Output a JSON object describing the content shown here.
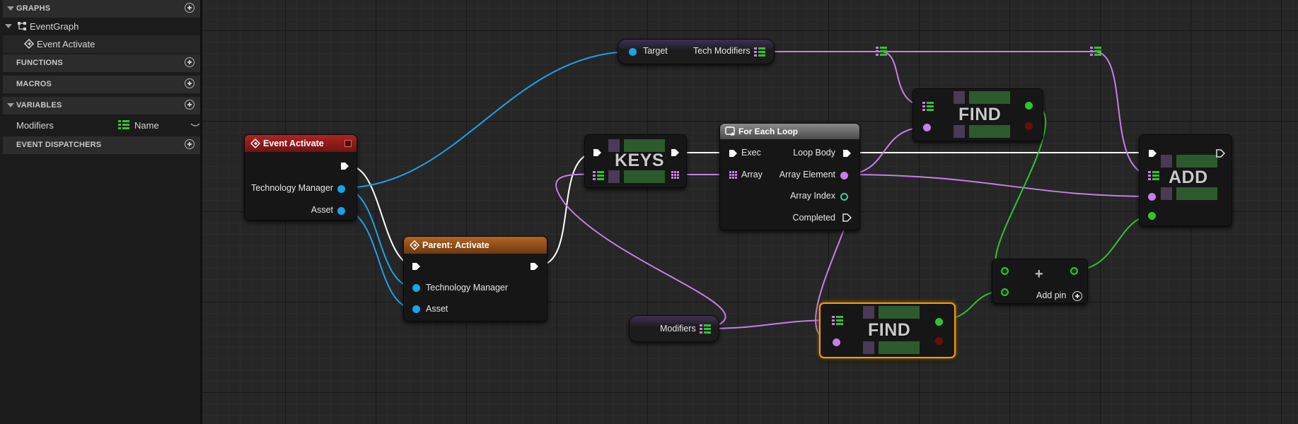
{
  "sidebar": {
    "graphs_label": "GRAPHS",
    "event_graph": "EventGraph",
    "event_activate": "Event Activate",
    "functions_label": "FUNCTIONS",
    "macros_label": "MACROS",
    "variables_label": "VARIABLES",
    "variable_name": "Modifiers",
    "variable_type": "Name",
    "dispatchers_label": "EVENT DISPATCHERS"
  },
  "nodes": {
    "event_activate": {
      "title": "Event Activate",
      "pin_tech": "Technology Manager",
      "pin_asset": "Asset"
    },
    "parent_activate": {
      "title": "Parent: Activate",
      "pin_tech": "Technology Manager",
      "pin_asset": "Asset"
    },
    "get_target": {
      "target": "Target",
      "tech_modifiers": "Tech Modifiers"
    },
    "keys": {
      "label": "KEYS"
    },
    "for_each": {
      "title": "For Each Loop",
      "exec": "Exec",
      "array": "Array",
      "loop_body": "Loop Body",
      "array_element": "Array Element",
      "array_index": "Array Index",
      "completed": "Completed"
    },
    "find_top": {
      "label": "FIND"
    },
    "find_bottom": {
      "label": "FIND"
    },
    "add": {
      "label": "ADD"
    },
    "modifiers": {
      "label": "Modifiers"
    },
    "add_math": {
      "symbol": "+",
      "add_pin": "Add pin"
    }
  },
  "colors": {
    "exec": "#ffffff",
    "object": "#1aa3e8",
    "name": "#c77ee8",
    "bool": "#2ec52e",
    "event_header": "#a11d1d",
    "parent_header": "#a0551b",
    "selected": "#f0a010"
  }
}
